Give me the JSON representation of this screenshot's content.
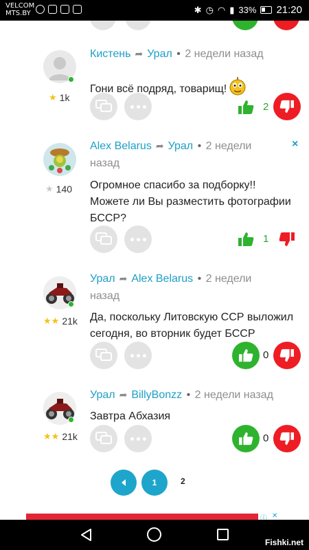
{
  "status_bar": {
    "carrier_line1": "VELCOM",
    "carrier_line2": "MTS.BY",
    "battery": "33%",
    "time": "21:20"
  },
  "comments": [
    {
      "author": "Кистень",
      "reply_to": "Урал",
      "time": "2 недели назад",
      "rating": "1k",
      "text": "Гони всё подряд, товарищ!",
      "upvotes": "2"
    },
    {
      "author": "Alex Belarus",
      "reply_to": "Урал",
      "time": "2 недели назад",
      "rating": "140",
      "text": "Огромное спасибо за подборку!! Можете ли Вы разместить фотографии БССР?",
      "upvotes": "1",
      "close_label": "×"
    },
    {
      "author": "Урал",
      "reply_to": "Alex Belarus",
      "time": "2 недели назад",
      "rating": "21k",
      "text": "Да, поскольку Литовскую ССР выложил сегодня, во вторник будет БССР",
      "upvotes": "0"
    },
    {
      "author": "Урал",
      "reply_to": "BillyBonzz",
      "time": "2 недели назад",
      "rating": "21k",
      "text": "Завтра Абхазия",
      "upvotes": "0"
    }
  ],
  "pagination": {
    "page1": "1",
    "current": "2"
  },
  "navbar": {
    "watermark": "Fishki.net"
  },
  "colors": {
    "link": "#1d9fc6",
    "upvote": "#2fb32f",
    "downvote": "#ee1d24"
  }
}
